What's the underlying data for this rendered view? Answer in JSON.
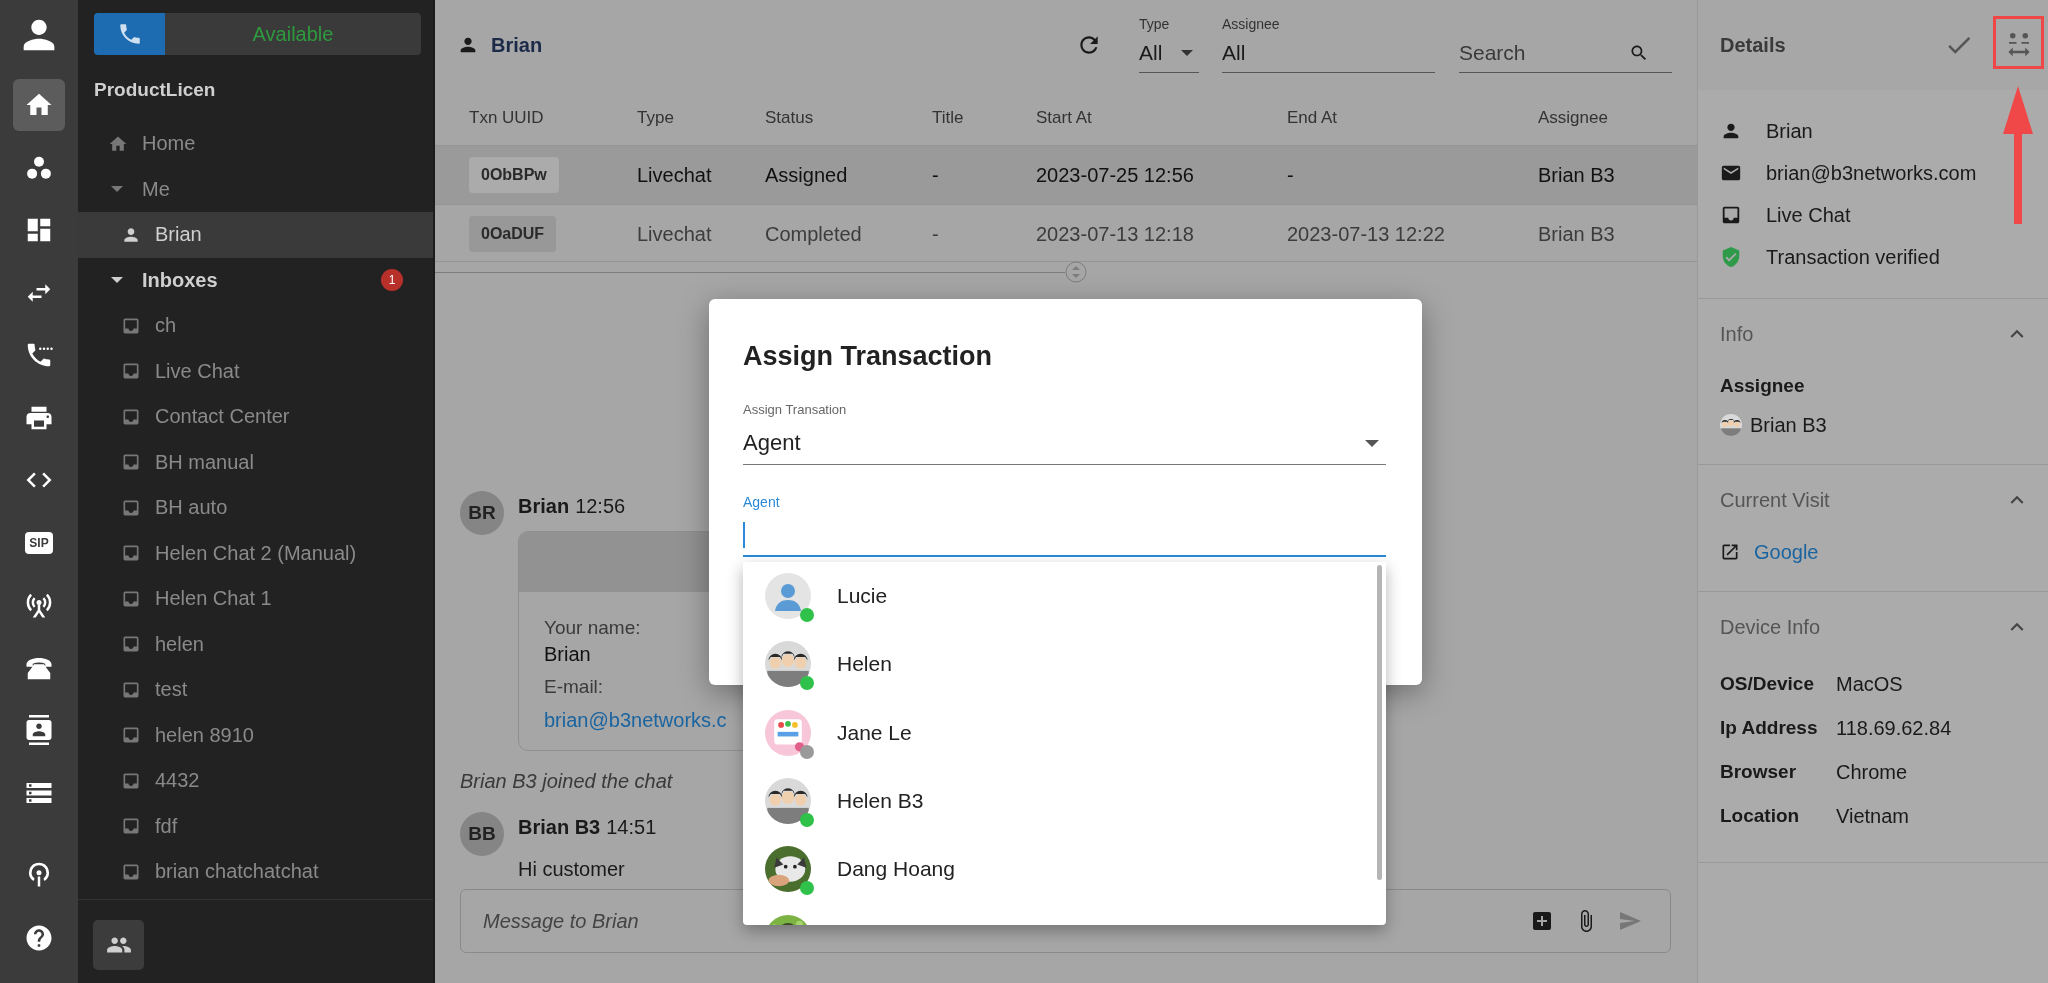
{
  "rail": {
    "items": [
      {
        "selected": true
      },
      {
        "selected": false
      },
      {
        "selected": false
      },
      {
        "selected": false
      },
      {
        "selected": false
      },
      {
        "selected": false
      },
      {
        "selected": false
      },
      {
        "label": "SIP",
        "selected": false
      },
      {
        "selected": false
      },
      {
        "selected": false
      },
      {
        "selected": false
      },
      {
        "selected": false
      }
    ],
    "footer_items": [
      {
        "selected": false
      },
      {
        "selected": false
      }
    ]
  },
  "sidebar": {
    "status": "Available",
    "org": "ProductLicen",
    "nav": [
      {
        "kind": "link",
        "label": "Home",
        "selected": false
      },
      {
        "kind": "group",
        "label": "Me",
        "expanded": true,
        "unread": false,
        "children": [
          {
            "kind": "person",
            "label": "Brian",
            "selected": true
          }
        ]
      },
      {
        "kind": "group",
        "label": "Inboxes",
        "expanded": true,
        "unread": true,
        "badge": "1",
        "children": [
          {
            "kind": "inbox",
            "label": "ch",
            "selected": false
          },
          {
            "kind": "inbox",
            "label": "Live Chat",
            "selected": false
          },
          {
            "kind": "inbox",
            "label": "Contact Center",
            "selected": false
          },
          {
            "kind": "inbox",
            "label": "BH manual",
            "selected": false
          },
          {
            "kind": "inbox",
            "label": "BH auto",
            "selected": false
          },
          {
            "kind": "inbox",
            "label": "Helen Chat 2 (Manual)",
            "selected": false
          },
          {
            "kind": "inbox",
            "label": "Helen Chat 1",
            "selected": false
          },
          {
            "kind": "inbox",
            "label": "helen",
            "selected": false
          },
          {
            "kind": "inbox",
            "label": "test",
            "selected": false
          },
          {
            "kind": "inbox",
            "label": "helen 8910",
            "selected": false
          },
          {
            "kind": "inbox",
            "label": "4432",
            "selected": false
          },
          {
            "kind": "inbox",
            "label": "fdf",
            "selected": false
          },
          {
            "kind": "inbox",
            "label": "brian chatchatchat",
            "selected": false
          }
        ]
      }
    ]
  },
  "header": {
    "title": "Brian",
    "filters": [
      {
        "kind": "select",
        "label": "Type",
        "value": "All"
      },
      {
        "kind": "text",
        "label": "Assignee",
        "value": "All"
      }
    ],
    "search": {
      "placeholder": "Search"
    }
  },
  "table": {
    "columns": [
      "Txn UUID",
      "Type",
      "Status",
      "Title",
      "Start At",
      "End At",
      "Assignee"
    ],
    "rows": [
      {
        "selected": true,
        "cells": [
          "0ObBPw",
          "Livechat",
          "Assigned",
          "-",
          "2023-07-25 12:56",
          "-",
          "Brian B3"
        ]
      },
      {
        "selected": false,
        "cells": [
          "0OaDUF",
          "Livechat",
          "Completed",
          "-",
          "2023-07-13 12:18",
          "2023-07-13 12:22",
          "Brian B3"
        ]
      }
    ]
  },
  "chat": {
    "messages": [
      {
        "kind": "form",
        "initials": "BR",
        "author": "Brian",
        "time": "12:56",
        "fields": [
          {
            "label": "Your name:",
            "value": "Brian",
            "link": false
          },
          {
            "label": "E-mail:",
            "value": "brian@b3networks.c",
            "link": true
          }
        ]
      },
      {
        "kind": "event",
        "text": "Brian B3 joined the chat"
      },
      {
        "kind": "text",
        "initials": "BB",
        "author": "Brian B3",
        "time": "14:51",
        "text": "Hi customer"
      }
    ],
    "composer": {
      "placeholder": "Message to Brian"
    }
  },
  "details": {
    "title": "Details",
    "contact": [
      {
        "kind": "person",
        "text": "Brian"
      },
      {
        "kind": "email",
        "text": "brian@b3networks.com"
      },
      {
        "kind": "inbox",
        "text": "Live Chat"
      },
      {
        "kind": "verified",
        "text": "Transaction verified"
      }
    ],
    "sections": [
      {
        "kind": "assignee",
        "title": "Info",
        "expanded": true,
        "label": "Assignee",
        "value": "Brian B3"
      },
      {
        "kind": "link",
        "title": "Current Visit",
        "expanded": true,
        "value": "Google"
      },
      {
        "kind": "props",
        "title": "Device Info",
        "expanded": true,
        "rows": [
          {
            "key": "OS/Device",
            "value": "MacOS"
          },
          {
            "key": "Ip Address",
            "value": "118.69.62.84"
          },
          {
            "key": "Browser",
            "value": "Chrome"
          },
          {
            "key": "Location",
            "value": "Vietnam"
          }
        ]
      }
    ]
  },
  "dialog": {
    "title": "Assign Transaction",
    "select": {
      "label": "Assign Transation",
      "value": "Agent"
    },
    "agent_field": {
      "label": "Agent",
      "focused": true
    },
    "options": [
      {
        "name": "Lucie",
        "online": true
      },
      {
        "name": "Helen",
        "kind": "picture",
        "online": true
      },
      {
        "name": "Jane Le",
        "kind": "picture",
        "online": false
      },
      {
        "name": "Helen B3",
        "kind": "picture",
        "online": true
      },
      {
        "name": "Dang Hoang",
        "kind": "picture",
        "online": true
      },
      {
        "kind": "picture"
      }
    ]
  },
  "annotation": {
    "kind": "highlight-arrow"
  }
}
